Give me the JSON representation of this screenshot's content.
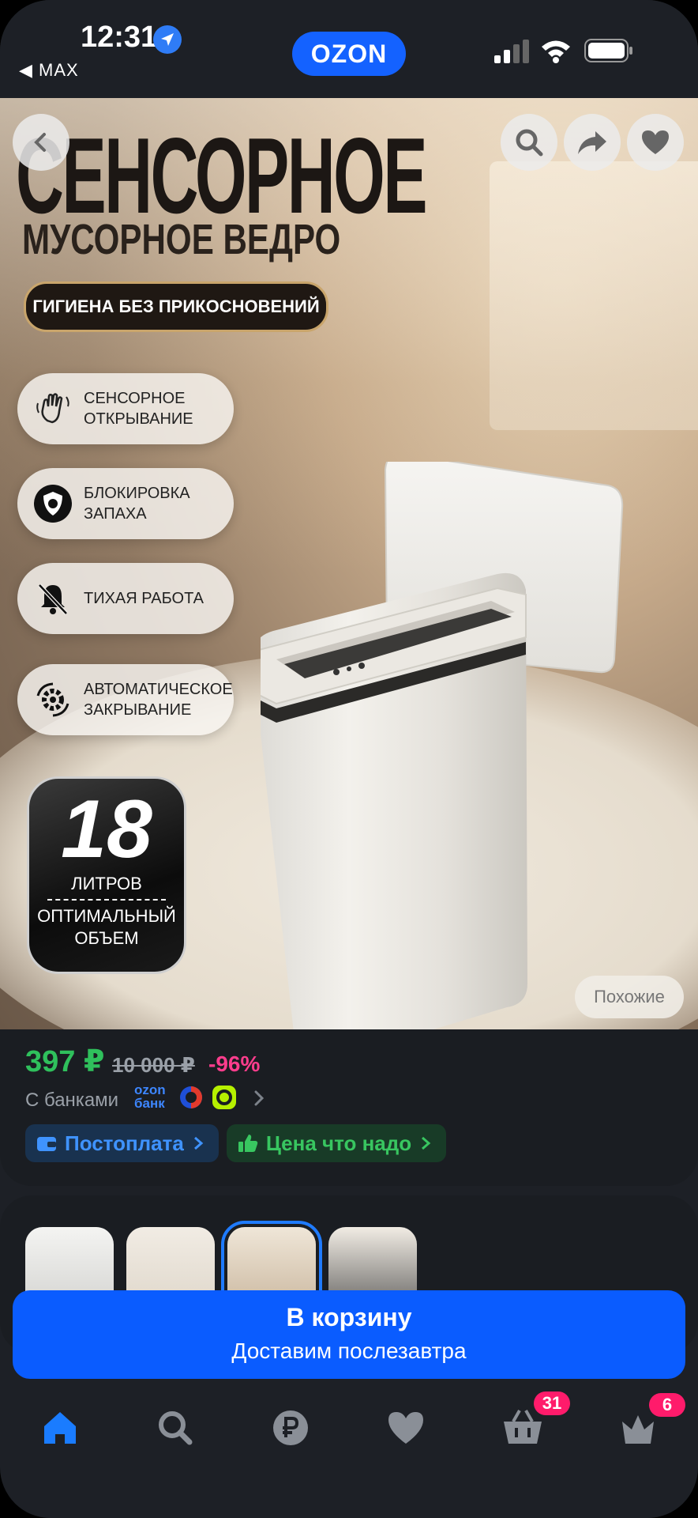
{
  "status_bar": {
    "time": "12:31",
    "back_app": "◀ MAX",
    "brand": "OZON"
  },
  "hero": {
    "title": "СЕНСОРНОЕ",
    "subtitle": "МУСОРНОЕ ВЕДРО",
    "tagline": "ГИГИЕНА БЕЗ ПРИКОСНОВЕНИЙ",
    "features": [
      {
        "icon": "hand-wave-icon",
        "l1": "СЕНСОРНОЕ",
        "l2": "ОТКРЫВАНИЕ"
      },
      {
        "icon": "shield-virus-icon",
        "l1": "БЛОКИРОВКА",
        "l2": "ЗАПАХА"
      },
      {
        "icon": "bell-off-icon",
        "l1": "ТИХАЯ РАБОТА",
        "l2": ""
      },
      {
        "icon": "auto-gear-icon",
        "l1": "АВТОМАТИЧЕСКОЕ",
        "l2": "ЗАКРЫВАНИЕ"
      }
    ],
    "badge": {
      "number": "18",
      "unit": "ЛИТРОВ",
      "desc1": "ОПТИМАЛЬНЫЙ",
      "desc2": "ОБЪЕМ"
    },
    "similar_label": "Похожие"
  },
  "price": {
    "current": "397 ₽",
    "old": "10 000 ₽",
    "discount": "-96%",
    "banks_label": "С банками",
    "ozon_bank_l1": "ozon",
    "ozon_bank_l2": "банк"
  },
  "chips": [
    {
      "label": "Постоплата",
      "icon": "wallet-icon"
    },
    {
      "label": "Цена что надо",
      "icon": "thumbs-up-icon"
    }
  ],
  "cart": {
    "title": "В корзину",
    "subtitle": "Доставим послезавтра"
  },
  "tabbar": {
    "cart_count": "31",
    "orders_count": "6"
  },
  "colors": {
    "accent": "#0a5cff",
    "price_green": "#2fc05c",
    "discount_pink": "#ff3d8d"
  }
}
